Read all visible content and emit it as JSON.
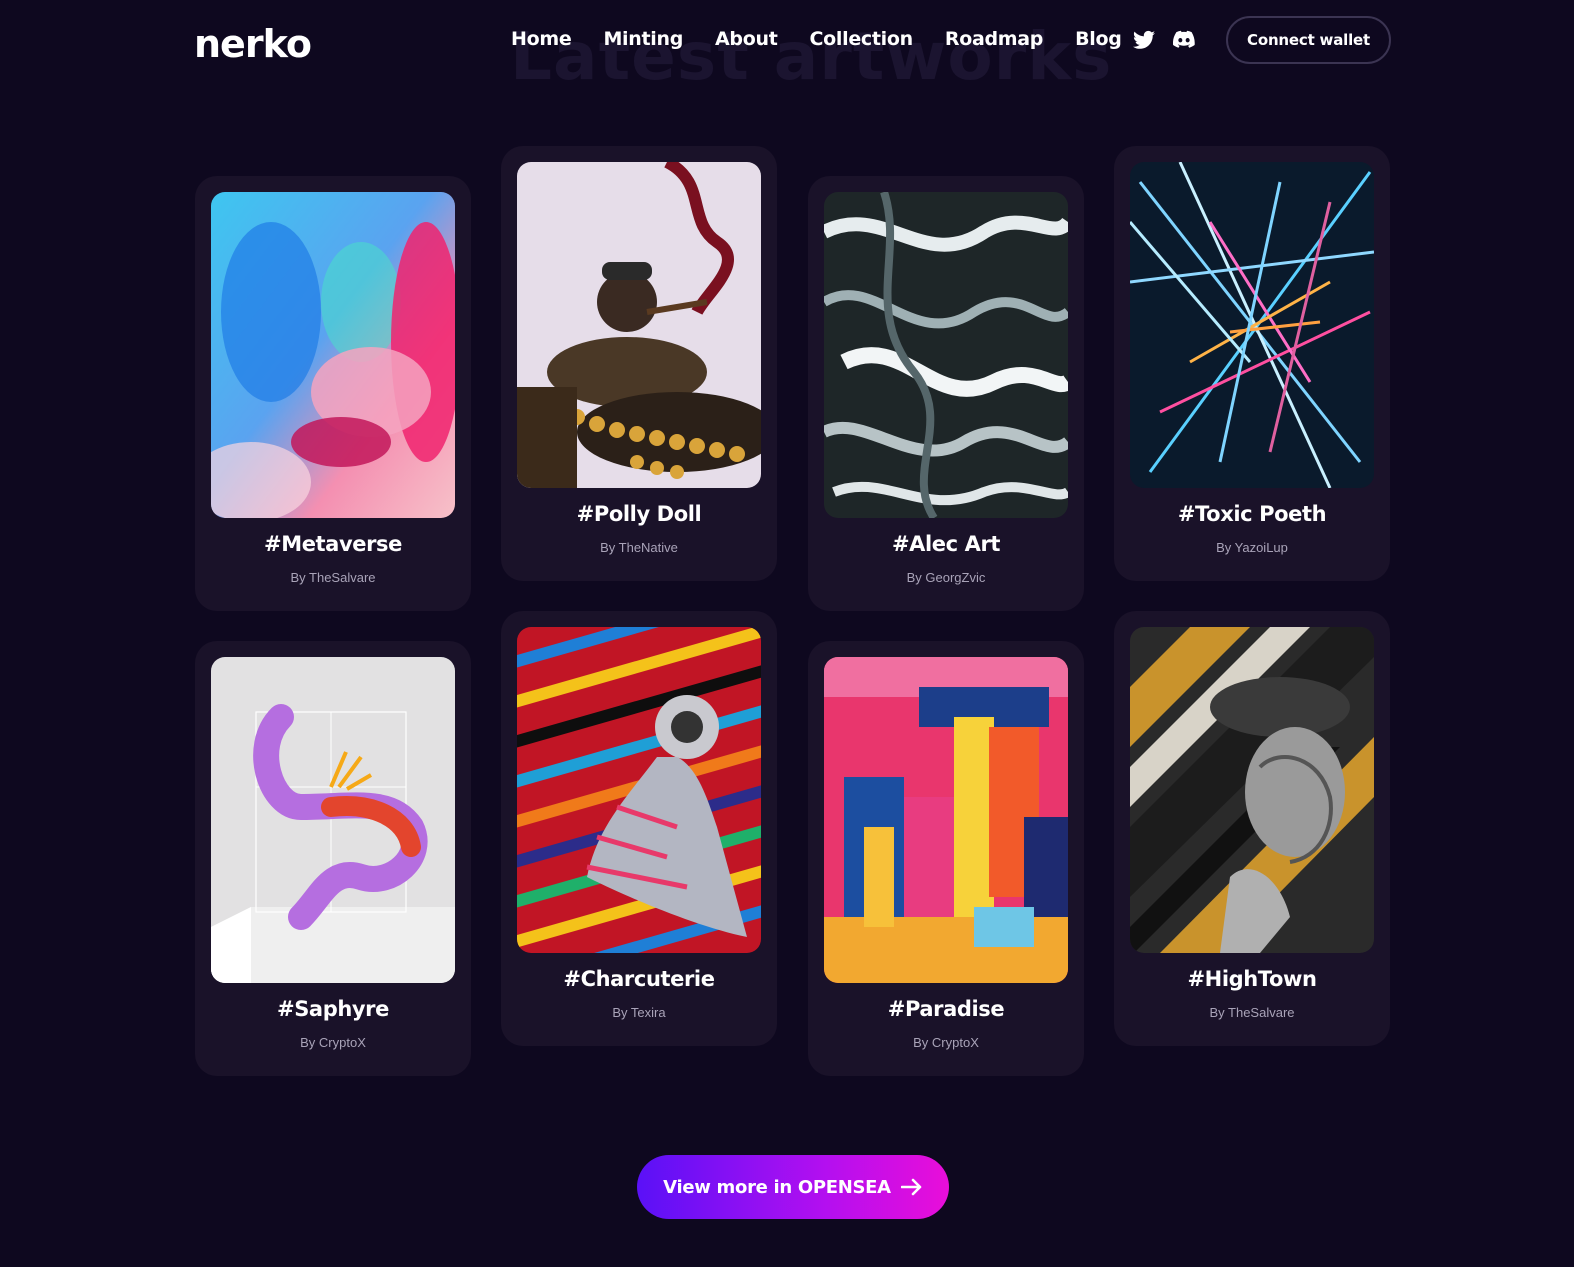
{
  "brand": {
    "logo_text": "nerko"
  },
  "section": {
    "ghost_title": "Latest artworks"
  },
  "nav": {
    "items": [
      "Home",
      "Minting",
      "About",
      "Collection",
      "Roadmap",
      "Blog"
    ]
  },
  "socials": {
    "icons": [
      "twitter-icon",
      "discord-icon"
    ]
  },
  "header": {
    "connect_label": "Connect wallet"
  },
  "artworks": [
    {
      "title": "#Metaverse",
      "author": "By TheSalvare"
    },
    {
      "title": "#Polly Doll",
      "author": "By TheNative"
    },
    {
      "title": "#Alec Art",
      "author": "By GeorgZvic"
    },
    {
      "title": "#Toxic Poeth",
      "author": "By YazoiLup"
    },
    {
      "title": "#Saphyre",
      "author": "By CryptoX"
    },
    {
      "title": "#Charcuterie",
      "author": "By Texira"
    },
    {
      "title": "#Paradise",
      "author": "By CryptoX"
    },
    {
      "title": "#HighTown",
      "author": "By TheSalvare"
    }
  ],
  "cta": {
    "opensea_label": "View more in OPENSEA",
    "icon": "arrow-right-icon"
  },
  "colors": {
    "background": "#0e081f",
    "card": "#1a1229",
    "button_gradient_start": "#5a11f7",
    "button_gradient_end": "#e90ed9"
  }
}
